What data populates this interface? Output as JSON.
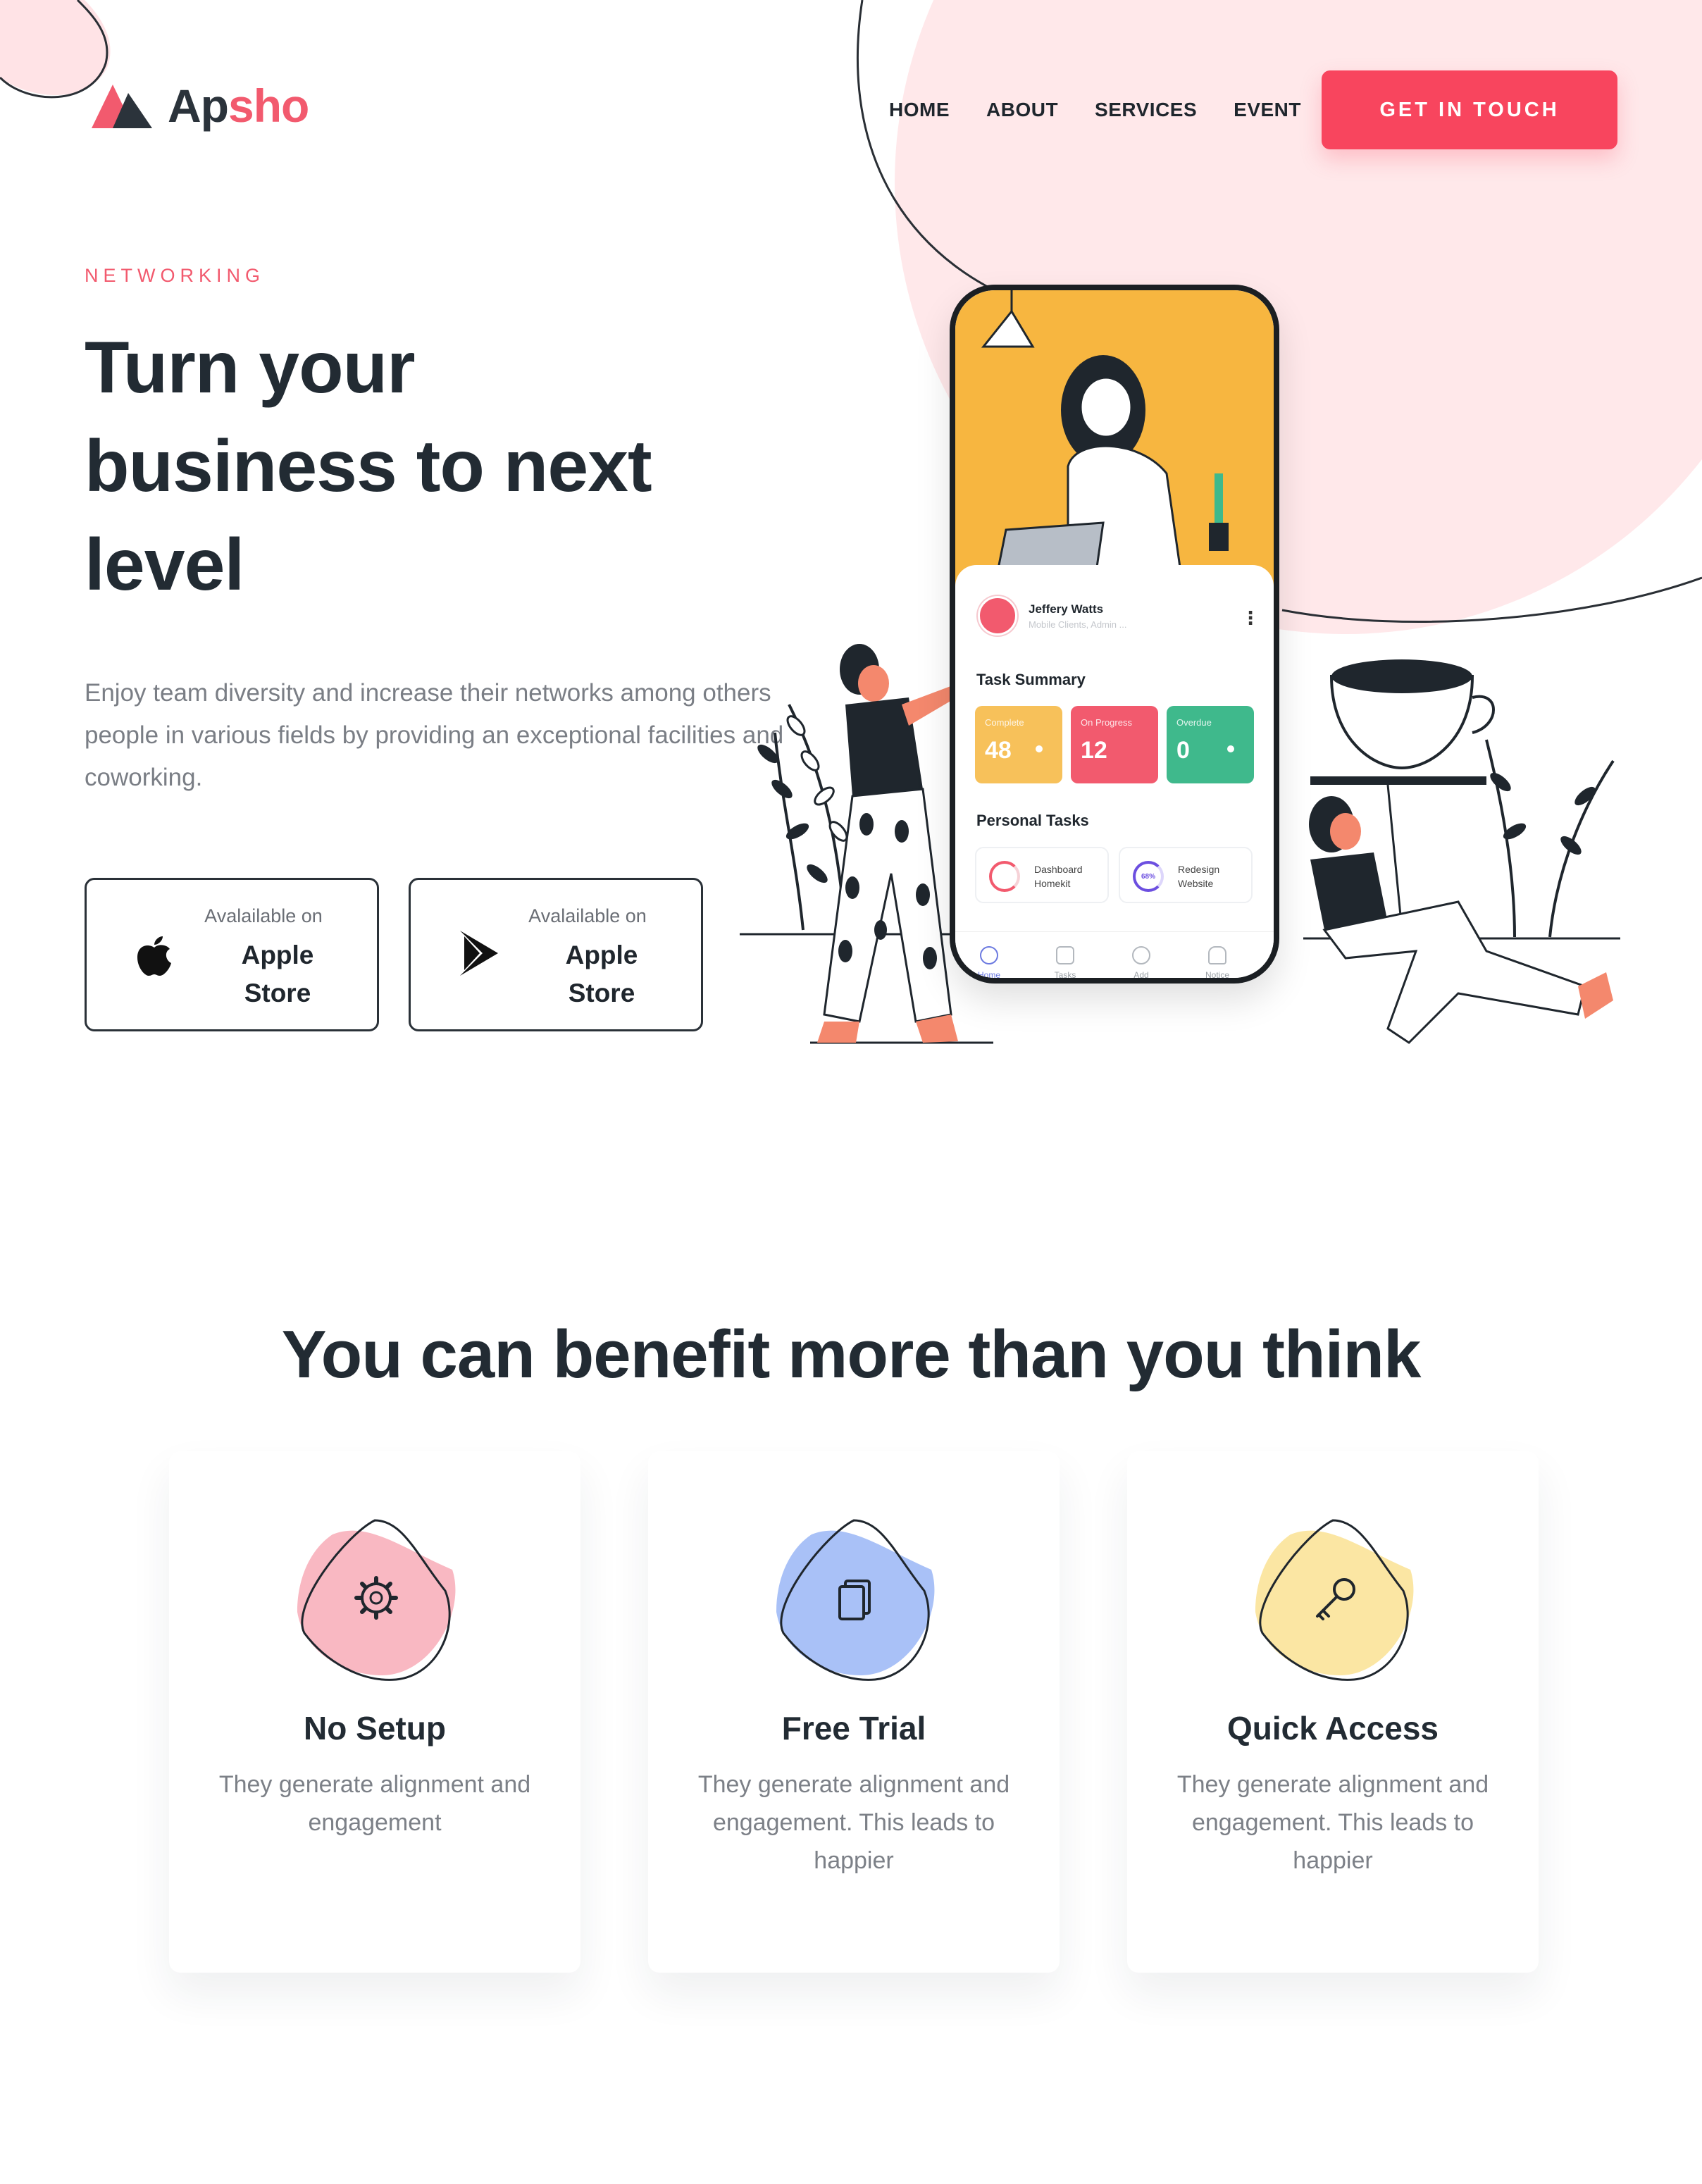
{
  "brand": {
    "name_part1": "Ap",
    "name_part2": "sho",
    "accent": "#f25a6e",
    "dark": "#2b333b"
  },
  "nav": {
    "items": [
      "HOME",
      "ABOUT",
      "SERVICES",
      "EVENT"
    ]
  },
  "cta": {
    "label": "GET IN TOUCH",
    "color": "#f8455e"
  },
  "hero": {
    "eyebrow": "NETWORKING",
    "title_line1": "Turn your",
    "title_line2": "business to next",
    "title_line3": "level",
    "description": "Enjoy team diversity and increase their networks among others people in various fields by providing an exceptional facilities and coworking."
  },
  "stores": [
    {
      "small": "Avalailable on",
      "line1": "Apple",
      "line2": "Store",
      "icon": "apple-icon"
    },
    {
      "small": "Avalailable on",
      "line1": "Apple",
      "line2": "Store",
      "icon": "play-store-icon"
    }
  ],
  "phone": {
    "user_name": "Jeffery Watts",
    "user_sub": "Mobile Clients, Admin ...",
    "task_summary": "Task Summary",
    "stats": [
      {
        "label": "Complete",
        "value": "48",
        "color": "#f7c15a"
      },
      {
        "label": "On Progress",
        "value": "12",
        "color": "#f25a6e"
      },
      {
        "label": "Overdue",
        "value": "0",
        "color": "#3fb98c"
      }
    ],
    "personal_tasks": "Personal Tasks",
    "tasks": [
      {
        "line1": "Dashboard",
        "line2": "Homekit"
      },
      {
        "line1": "Redesign",
        "line2": "Website",
        "progress": "68%"
      }
    ],
    "tabs": [
      "Home",
      "Tasks",
      "Add",
      "Notice"
    ]
  },
  "benefits": {
    "title": "You can benefit more than you think",
    "cards": [
      {
        "title": "No Setup",
        "desc": "They generate alignment and engagement",
        "icon": "gear-icon",
        "color": "#f9b8c2"
      },
      {
        "title": "Free Trial",
        "desc": "They generate alignment and engagement. This leads to happier",
        "icon": "document-icon",
        "color": "#a9c1f7"
      },
      {
        "title": "Quick Access",
        "desc": "They generate alignment and engagement. This leads to happier",
        "icon": "key-icon",
        "color": "#fbe6a3"
      }
    ]
  }
}
